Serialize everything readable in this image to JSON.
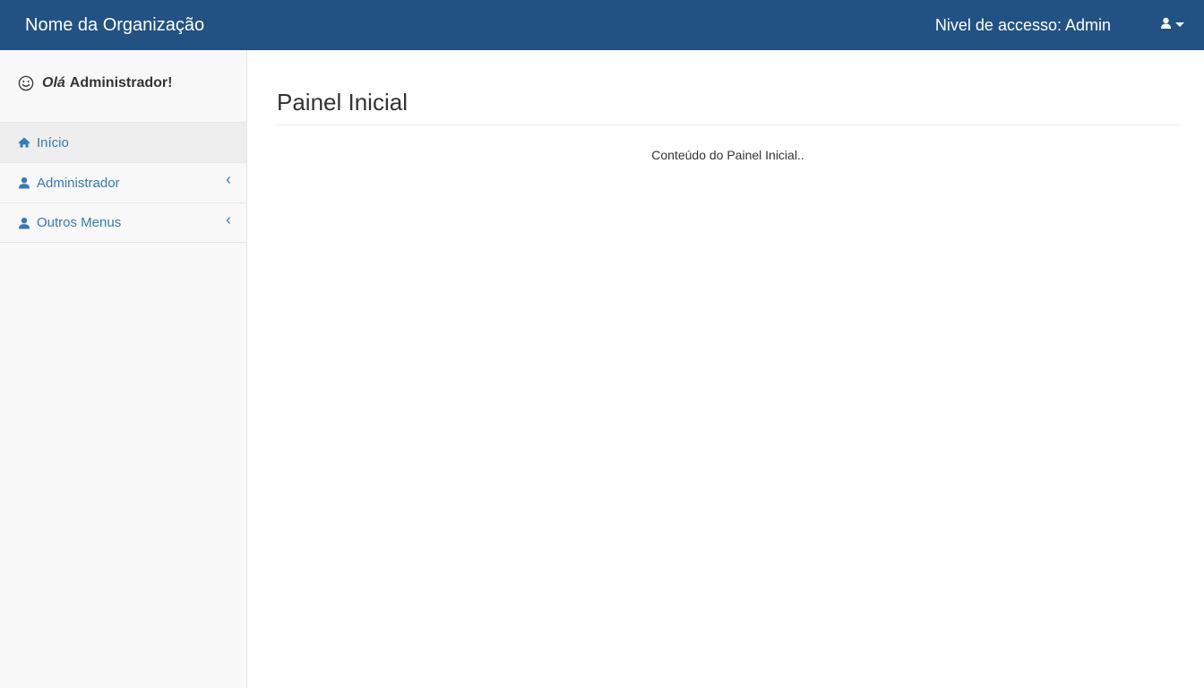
{
  "navbar": {
    "brand": "Nome da Organização",
    "access_level": "Nivel de accesso: Admin",
    "user_menu_icon": "user-icon",
    "dropdown_icon": "caret-down-icon",
    "background_color": "#215283"
  },
  "sidebar": {
    "greeting": {
      "icon": "smile-icon",
      "hello": "Olá",
      "name": "Administrador!"
    },
    "items": [
      {
        "label": "Início",
        "icon": "home-icon",
        "active": true,
        "has_submenu": false
      },
      {
        "label": "Administrador",
        "icon": "user-icon",
        "active": false,
        "has_submenu": true
      },
      {
        "label": "Outros Menus",
        "icon": "user-icon",
        "active": false,
        "has_submenu": true
      }
    ],
    "link_color": "#337ab7"
  },
  "main": {
    "title": "Painel Inicial",
    "content": "Conteúdo do Painel Inicial.."
  }
}
